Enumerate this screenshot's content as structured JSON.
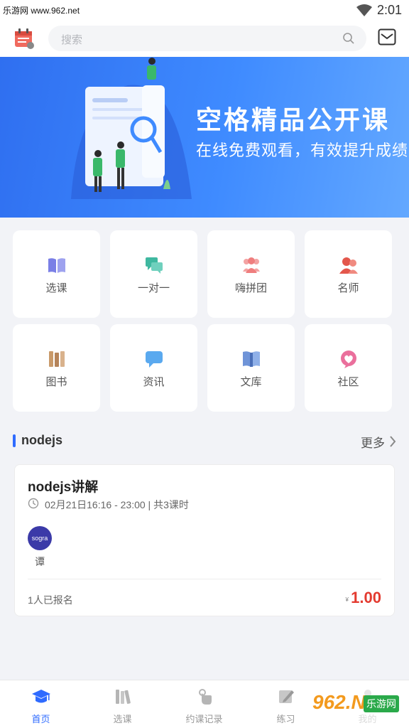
{
  "status_bar": {
    "watermark": "乐游网 www.962.net",
    "time": "2:01"
  },
  "header": {
    "search_placeholder": "搜索"
  },
  "banner": {
    "title": "空格精品公开课",
    "subtitle": "在线免费观看，有效提升成绩"
  },
  "menu": [
    {
      "label": "选课",
      "icon": "book-open-icon",
      "color": "#7a7fe6"
    },
    {
      "label": "一对一",
      "icon": "chat-bubbles-icon",
      "color": "#3fb8a0"
    },
    {
      "label": "嗨拼团",
      "icon": "group-icon",
      "color": "#ef7e7e"
    },
    {
      "label": "名师",
      "icon": "teacher-icon",
      "color": "#e3574c"
    },
    {
      "label": "图书",
      "icon": "books-icon",
      "color": "#c99a6a"
    },
    {
      "label": "资讯",
      "icon": "message-icon",
      "color": "#5aa9ef"
    },
    {
      "label": "文库",
      "icon": "library-icon",
      "color": "#6f94d8"
    },
    {
      "label": "社区",
      "icon": "heart-icon",
      "color": "#ea6f9c"
    }
  ],
  "section": {
    "title": "nodejs",
    "more": "更多"
  },
  "course": {
    "title": "nodejs讲解",
    "time": "02月21日16:16 - 23:00 | 共3课时",
    "teacher_name": "谭",
    "avatar_text": "sogra",
    "enrolled": "1人已报名",
    "currency": "¥",
    "price": "1.00"
  },
  "tabs": [
    {
      "label": "首页",
      "icon": "graduation-cap-icon",
      "active": true
    },
    {
      "label": "选课",
      "icon": "books-icon",
      "active": false
    },
    {
      "label": "约课记录",
      "icon": "hand-touch-icon",
      "active": false
    },
    {
      "label": "练习",
      "icon": "edit-icon",
      "active": false
    },
    {
      "label": "我的",
      "icon": "user-icon",
      "active": false
    }
  ],
  "watermark": {
    "brand": "962.NET",
    "site": "乐游网"
  },
  "colors": {
    "accent": "#2f6bff",
    "price": "#e33a2f",
    "banner": "#3f8bff"
  }
}
